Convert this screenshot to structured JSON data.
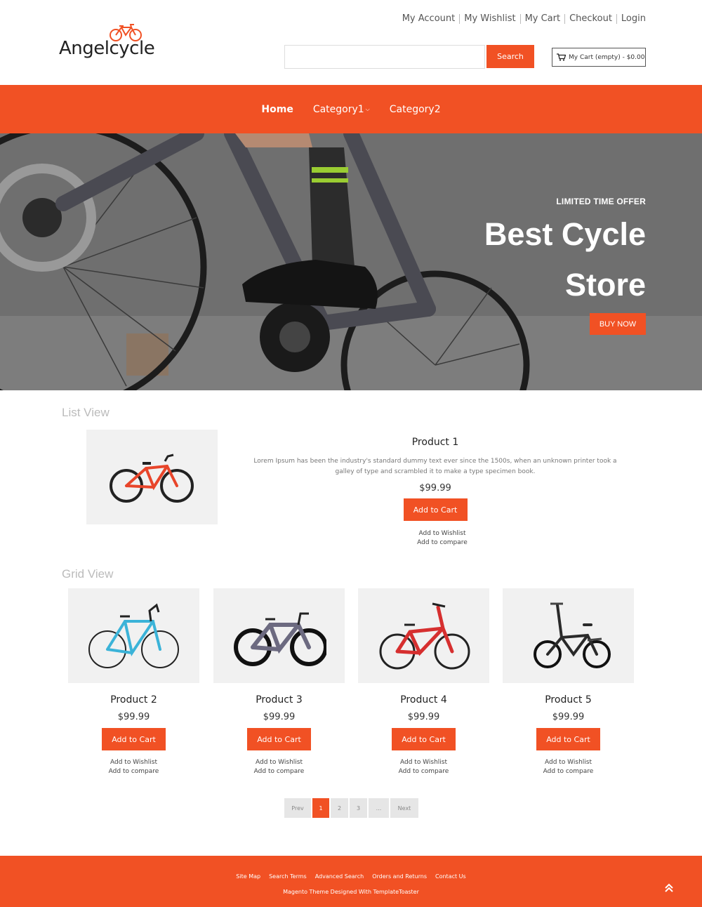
{
  "brand": {
    "name": "Angelcycle",
    "accent": "#f15124"
  },
  "toplinks": [
    "My Account",
    "My Wishlist",
    "My Cart",
    "Checkout",
    "Login"
  ],
  "search": {
    "placeholder": "",
    "button": "Search"
  },
  "cart": {
    "label": "My Cart (empty) - $0.00",
    "icon": "cart-icon"
  },
  "nav": [
    {
      "label": "Home"
    },
    {
      "label": "Category1"
    },
    {
      "label": "Category2"
    }
  ],
  "hero": {
    "subtitle": "LIMITED TIME OFFER",
    "title_line1": "Best Cycle",
    "title_line2": "Store",
    "button": "BUY NOW"
  },
  "list_view": {
    "heading": "List View",
    "product": {
      "name": "Product 1",
      "description": "Lorem Ipsum has been the industry's standard dummy text ever since the 1500s, when an unknown printer took a galley of type and scrambled it to make a type specimen book.",
      "price": "$99.99",
      "add_to_cart": "Add to Cart",
      "wishlist": "Add to Wishlist",
      "compare": "Add to compare"
    }
  },
  "grid_view": {
    "heading": "Grid View",
    "products": [
      {
        "name": "Product 2",
        "price": "$99.99",
        "add_to_cart": "Add to Cart",
        "wishlist": "Add to Wishlist",
        "compare": "Add to compare"
      },
      {
        "name": "Product 3",
        "price": "$99.99",
        "add_to_cart": "Add to Cart",
        "wishlist": "Add to Wishlist",
        "compare": "Add to compare"
      },
      {
        "name": "Product 4",
        "price": "$99.99",
        "add_to_cart": "Add to Cart",
        "wishlist": "Add to Wishlist",
        "compare": "Add to compare"
      },
      {
        "name": "Product 5",
        "price": "$99.99",
        "add_to_cart": "Add to Cart",
        "wishlist": "Add to Wishlist",
        "compare": "Add to compare"
      }
    ]
  },
  "pagination": {
    "prev": "Prev",
    "pages": [
      "1",
      "2",
      "3",
      "..."
    ],
    "current": "1",
    "next": "Next"
  },
  "footer": {
    "links": [
      "Site Map",
      "Search Terms",
      "Advanced Search",
      "Orders and Returns",
      "Contact Us"
    ],
    "credit": "Magento Theme Designed With TemplateToaster"
  }
}
